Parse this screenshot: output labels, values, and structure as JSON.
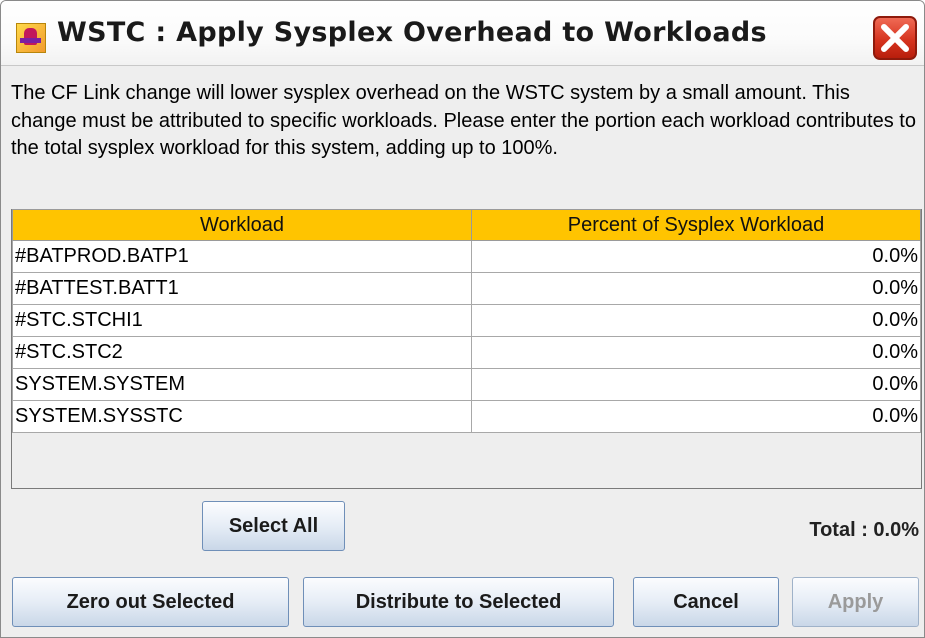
{
  "window": {
    "title": "WSTC : Apply Sysplex Overhead to Workloads"
  },
  "description": "The CF Link change will lower sysplex overhead on the WSTC system by a small amount. This change must be attributed to specific workloads. Please enter the portion each workload contributes to the total sysplex workload for this system, adding up to 100%.",
  "table": {
    "columns": [
      "Workload",
      "Percent of Sysplex Workload"
    ],
    "rows": [
      {
        "workload": "#BATPROD.BATP1",
        "percent": "0.0%"
      },
      {
        "workload": "#BATTEST.BATT1",
        "percent": "0.0%"
      },
      {
        "workload": "#STC.STCHI1",
        "percent": "0.0%"
      },
      {
        "workload": "#STC.STC2",
        "percent": "0.0%"
      },
      {
        "workload": "SYSTEM.SYSTEM",
        "percent": "0.0%"
      },
      {
        "workload": "SYSTEM.SYSSTC",
        "percent": "0.0%"
      }
    ]
  },
  "buttons": {
    "select_all": "Select All",
    "zero_out": "Zero out Selected",
    "distribute": "Distribute to Selected",
    "cancel": "Cancel",
    "apply": "Apply"
  },
  "total": "Total : 0.0%",
  "icons": {
    "app": "app-icon",
    "close": "close-icon"
  },
  "colors": {
    "header": "#ffc400",
    "close": "#d6341f"
  }
}
